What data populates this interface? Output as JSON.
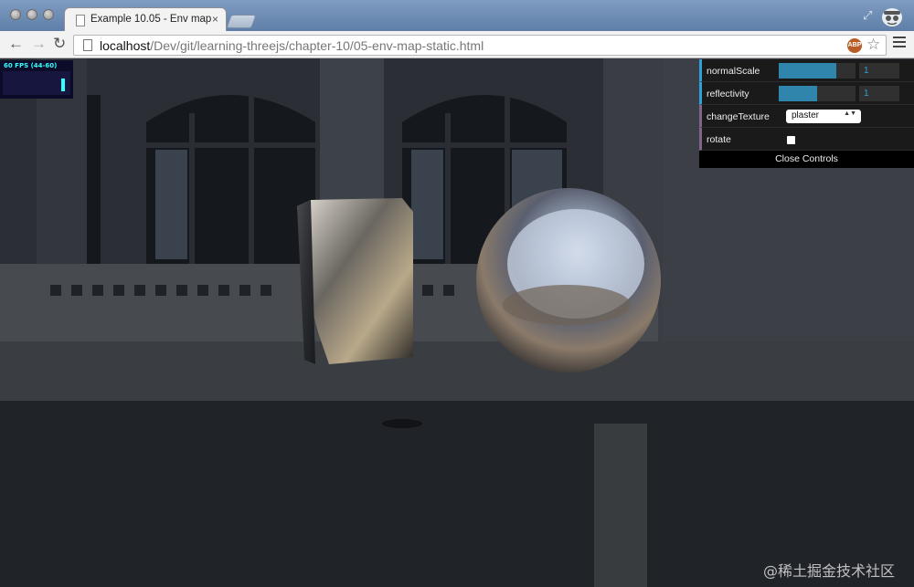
{
  "browser": {
    "tab_title": "Example 10.05 - Env map",
    "tab_close": "×",
    "url_host": "localhost",
    "url_path": "/Dev/git/learning-threejs/chapter-10/05-env-map-static.html",
    "back": "←",
    "forward": "→",
    "reload": "↻",
    "star": "☆",
    "extension_badge": "ABP",
    "fullscreen": "⤢"
  },
  "stats": {
    "fps_text": "60 FPS (44-60)"
  },
  "gui": {
    "controls": [
      {
        "label": "normalScale",
        "value": "1",
        "fraction": 0.75
      },
      {
        "label": "reflectivity",
        "value": "1",
        "fraction": 0.5
      }
    ],
    "texture": {
      "label": "changeTexture",
      "selected": "plaster"
    },
    "rotate": {
      "label": "rotate",
      "checked": true
    },
    "close_label": "Close Controls"
  },
  "watermark": "@稀土掘金技术社区",
  "colors": {
    "gui_number_accent": "#2fa1d6",
    "gui_option_accent": "#806787"
  },
  "icons": [
    "page-icon",
    "back-icon",
    "forward-icon",
    "reload-icon",
    "star-icon",
    "menu-icon",
    "incognito-icon",
    "fullscreen-icon",
    "checkbox-icon",
    "dropdown-arrow-icon"
  ]
}
